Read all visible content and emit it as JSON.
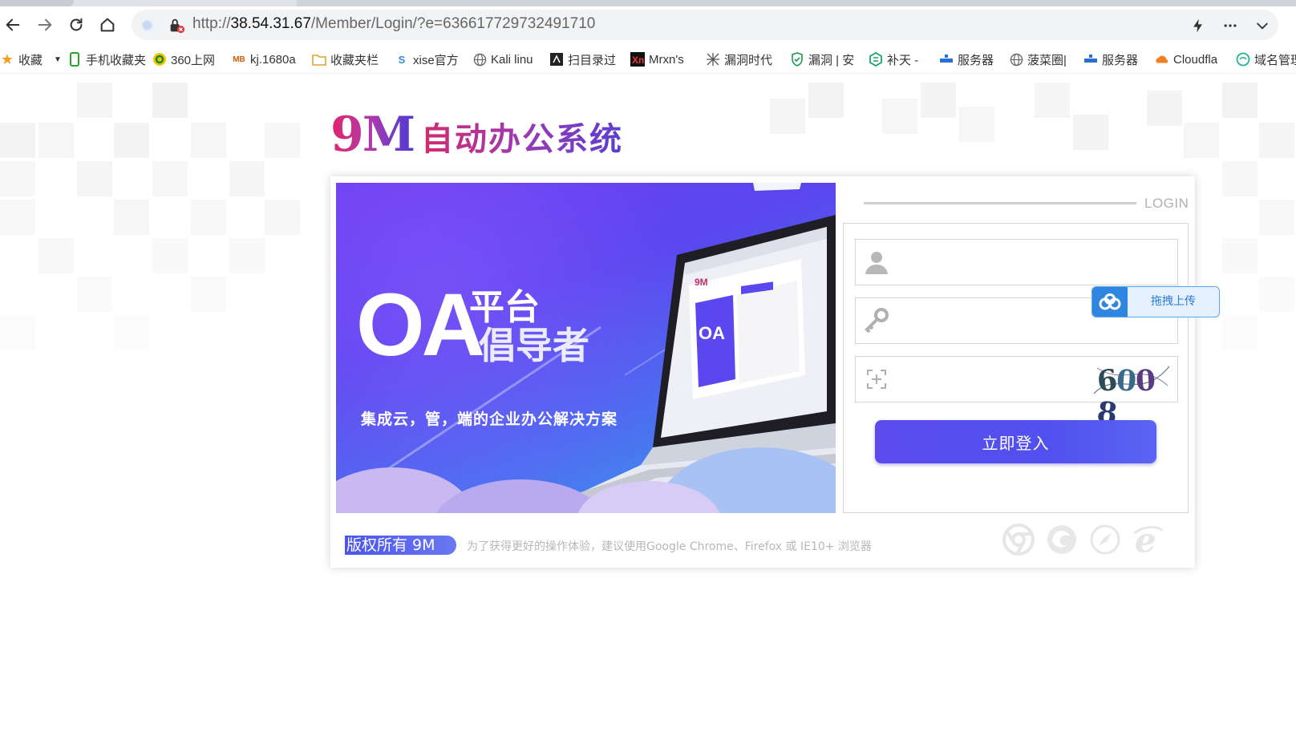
{
  "browser": {
    "url_prefix": "http://",
    "url_host": "38.54.31.67",
    "url_path": "/Member/Login/?e=636617729732491710"
  },
  "bookmarks": [
    {
      "label": "收藏",
      "icon": "star-icon"
    },
    {
      "label": "手机收藏夹",
      "icon": "phone-icon"
    },
    {
      "label": "360上网",
      "icon": "360-icon"
    },
    {
      "label": "kj.1680a",
      "icon": "mb-icon"
    },
    {
      "label": "收藏夹栏",
      "icon": "folder-icon"
    },
    {
      "label": "xise官方",
      "icon": "s-icon"
    },
    {
      "label": "Kali linu",
      "icon": "globe-icon"
    },
    {
      "label": "扫目录过",
      "icon": "scan-icon"
    },
    {
      "label": "Mrxn's",
      "icon": "mrxn-icon"
    },
    {
      "label": "漏洞时代",
      "icon": "cross-icon"
    },
    {
      "label": "漏洞 | 安",
      "icon": "shield-icon"
    },
    {
      "label": "补天 -",
      "icon": "butian-icon"
    },
    {
      "label": "服务器",
      "icon": "server-icon"
    },
    {
      "label": "菠菜圈|",
      "icon": "globe-icon"
    },
    {
      "label": "服务器",
      "icon": "server-icon"
    },
    {
      "label": "Cloudfla",
      "icon": "cloud-icon"
    },
    {
      "label": "域名管理",
      "icon": "domain-icon"
    }
  ],
  "logo": {
    "mark": "9M",
    "title": "自动办公系统"
  },
  "banner": {
    "oa": "OA",
    "line1": "平台",
    "line2": "倡导者",
    "subtitle": "集成云，管，端的企业办公解决方案"
  },
  "login": {
    "heading": "LOGIN",
    "username_value": "",
    "password_value": "",
    "captcha_value": "",
    "captcha_image_text": "6008",
    "submit_label": "立即登入"
  },
  "footer": {
    "copyright": "版权所有 9M",
    "browser_hint": "为了获得更好的操作体验，建议使用Google Chrome、Firefox 或 IE10+ 浏览器"
  },
  "upload_widget": {
    "label": "拖拽上传"
  },
  "colors": {
    "brand_purple": "#5b4bef",
    "brand_pink": "#e2246a",
    "upload_blue": "#2f86e0"
  }
}
